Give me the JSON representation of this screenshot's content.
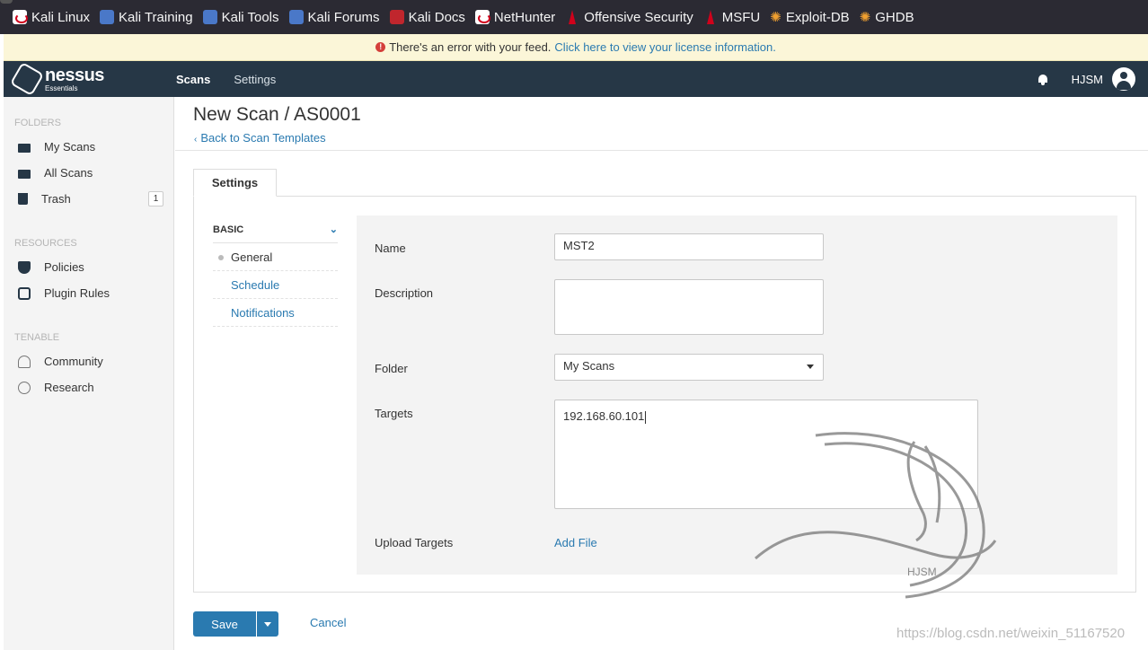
{
  "bookmarks": [
    {
      "label": "Kali Linux",
      "icon": "kali-dragon-icon"
    },
    {
      "label": "Kali Training",
      "icon": "kali-training-icon"
    },
    {
      "label": "Kali Tools",
      "icon": "kali-tools-icon"
    },
    {
      "label": "Kali Forums",
      "icon": "kali-forums-icon"
    },
    {
      "label": "Kali Docs",
      "icon": "kali-docs-icon"
    },
    {
      "label": "NetHunter",
      "icon": "nethunter-icon"
    },
    {
      "label": "Offensive Security",
      "icon": "offsec-icon"
    },
    {
      "label": "MSFU",
      "icon": "offsec-icon"
    },
    {
      "label": "Exploit-DB",
      "icon": "spider-icon"
    },
    {
      "label": "GHDB",
      "icon": "spider-icon"
    }
  ],
  "banner": {
    "message": "There's an error with your feed.",
    "link": "Click here to view your license information."
  },
  "topnav": {
    "logo_name": "nessus",
    "logo_sub": "Essentials",
    "tabs": [
      "Scans",
      "Settings"
    ],
    "username": "HJSM"
  },
  "sidebar": {
    "folders_head": "FOLDERS",
    "folders": [
      {
        "label": "My Scans",
        "icon": "folder-icon"
      },
      {
        "label": "All Scans",
        "icon": "folder-icon"
      },
      {
        "label": "Trash",
        "icon": "trash-icon",
        "badge": "1"
      }
    ],
    "resources_head": "RESOURCES",
    "resources": [
      {
        "label": "Policies",
        "icon": "shield-icon"
      },
      {
        "label": "Plugin Rules",
        "icon": "plugin-icon"
      }
    ],
    "tenable_head": "TENABLE",
    "tenable": [
      {
        "label": "Community",
        "icon": "community-icon"
      },
      {
        "label": "Research",
        "icon": "lightbulb-icon"
      }
    ]
  },
  "main": {
    "title": "New Scan / AS0001",
    "back_link": "Back to Scan Templates",
    "tab": "Settings",
    "subnav": {
      "head": "BASIC",
      "items": [
        "General",
        "Schedule",
        "Notifications"
      ]
    },
    "form": {
      "name_label": "Name",
      "name_value": "MST2",
      "description_label": "Description",
      "description_value": "",
      "folder_label": "Folder",
      "folder_value": "My Scans",
      "targets_label": "Targets",
      "targets_value": "192.168.60.101",
      "upload_label": "Upload Targets",
      "upload_link": "Add File"
    },
    "save_label": "Save",
    "cancel_label": "Cancel"
  },
  "watermark": {
    "text": "https://blog.csdn.net/weixin_51167520",
    "logo_text": "HJSM"
  },
  "colors": {
    "nav_bg": "#263746",
    "accent": "#2a7ab0",
    "banner_bg": "#fbf6d8",
    "error": "#d43f3a"
  }
}
